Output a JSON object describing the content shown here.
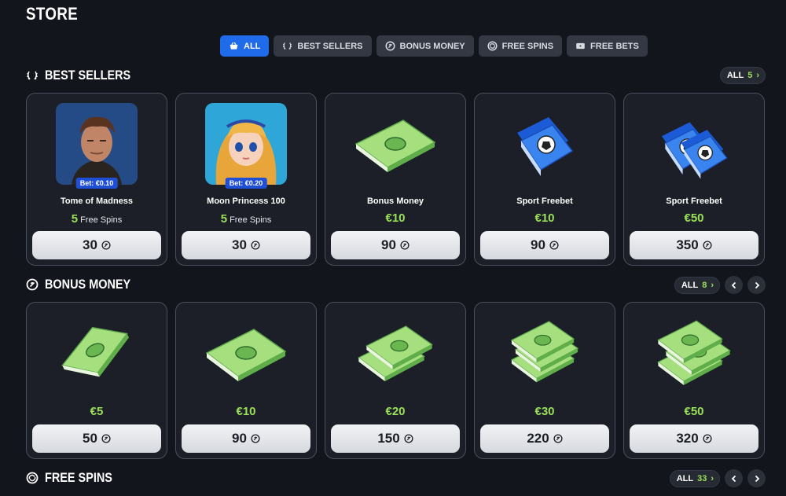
{
  "page": {
    "title": "STORE"
  },
  "filters": [
    {
      "label": "ALL",
      "icon": "basket-icon",
      "active": true
    },
    {
      "label": "BEST SELLERS",
      "icon": "laurel-icon",
      "active": false
    },
    {
      "label": "BONUS MONEY",
      "icon": "coin-icon",
      "active": false
    },
    {
      "label": "FREE SPINS",
      "icon": "spin-icon",
      "active": false
    },
    {
      "label": "FREE BETS",
      "icon": "ticket-icon",
      "active": false
    }
  ],
  "best_sellers": {
    "title": "BEST SELLERS",
    "all_label": "ALL",
    "count": "5",
    "items": [
      {
        "name": "Tome of Madness",
        "badge": "Bet: €0.10",
        "spins": "5",
        "spins_label": "Free Spins",
        "cost": "30"
      },
      {
        "name": "Moon Princess 100",
        "badge": "Bet: €0.20",
        "spins": "5",
        "spins_label": "Free Spins",
        "cost": "30"
      },
      {
        "name": "Bonus Money",
        "value": "€10",
        "cost": "90"
      },
      {
        "name": "Sport Freebet",
        "value": "€10",
        "cost": "90"
      },
      {
        "name": "Sport Freebet",
        "value": "€50",
        "cost": "350"
      }
    ]
  },
  "bonus_money": {
    "title": "BONUS MONEY",
    "all_label": "ALL",
    "count": "8",
    "items": [
      {
        "value": "€5",
        "cost": "50"
      },
      {
        "value": "€10",
        "cost": "90"
      },
      {
        "value": "€20",
        "cost": "150"
      },
      {
        "value": "€30",
        "cost": "220"
      },
      {
        "value": "€50",
        "cost": "320"
      }
    ]
  },
  "free_spins": {
    "title": "FREE SPINS",
    "all_label": "ALL",
    "count": "33"
  },
  "colors": {
    "accent": "#1f6bea",
    "green": "#9be05a",
    "card_bg": "#1c1f27",
    "page_bg": "#12151c"
  }
}
